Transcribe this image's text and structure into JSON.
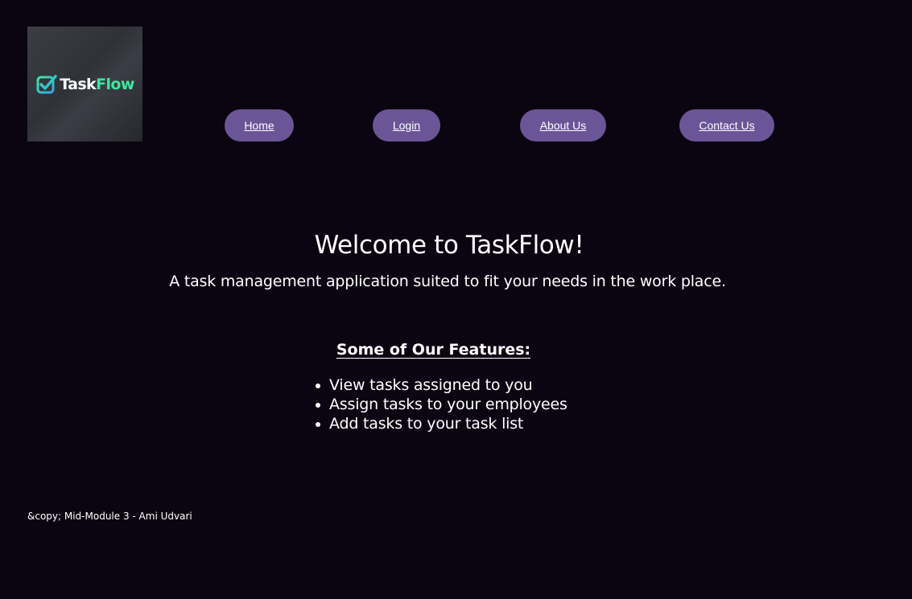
{
  "logo": {
    "text_task": "Task",
    "text_flow": "Flow",
    "check_color": "#2fd1e0",
    "flow_color": "#3ee6a0"
  },
  "nav": {
    "home": "Home",
    "login": "Login",
    "about": "About Us",
    "contact": "Contact Us"
  },
  "hero": {
    "title": "Welcome to TaskFlow!",
    "subtitle": "A task management application suited to fit your needs in the work place."
  },
  "features": {
    "heading": "Some of Our Features:",
    "items": [
      "View tasks assigned to you",
      "Assign tasks to your employees",
      "Add tasks to your task list"
    ]
  },
  "footer": {
    "text": "&copy; Mid-Module 3 - Ami Udvari"
  },
  "colors": {
    "background": "#0b0511",
    "button": "#6a5697",
    "text": "#ffffff"
  }
}
